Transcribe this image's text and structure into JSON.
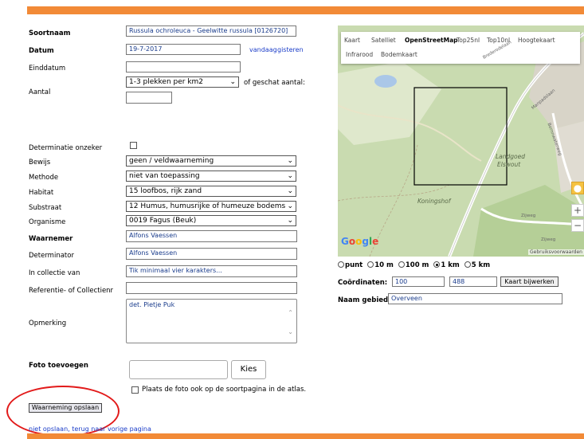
{
  "form": {
    "soortnaam_label": "Soortnaam",
    "soortnaam_value": "Russula ochroleuca - Geelwitte russula [0126720]",
    "datum_label": "Datum",
    "datum_value": "19-7-2017",
    "vandaag": "vandaag",
    "gisteren": "gisteren",
    "einddatum_label": "Einddatum",
    "einddatum_value": "",
    "aantal_label": "Aantal",
    "aantal_select": "1-3 plekken per km2",
    "geschat_label": "of geschat aantal:",
    "geschat_value": "",
    "determinatie_label": "Determinatie onzeker",
    "bewijs_label": "Bewijs",
    "bewijs_value": "geen / veldwaarneming",
    "methode_label": "Methode",
    "methode_value": "niet van toepassing",
    "habitat_label": "Habitat",
    "habitat_value": "15 loofbos, rijk zand",
    "substraat_label": "Substraat",
    "substraat_value": "12 Humus, humusrijke of humeuze bodems",
    "organisme_label": "Organisme",
    "organisme_value": "0019 Fagus (Beuk)",
    "waarnemer_label": "Waarnemer",
    "waarnemer_value": "Alfons Vaessen",
    "determinator_label": "Determinator",
    "determinator_value": "Alfons Vaessen",
    "collectie_label": "In collectie van",
    "collectie_placeholder": "Tik minimaal vier karakters...",
    "referentie_label": "Referentie- of Collectienr",
    "referentie_value": "",
    "opmerking_label": "Opmerking",
    "opmerking_value": "det. Pietje Puk",
    "foto_label": "Foto toevoegen",
    "kies_label": "Kies",
    "plaats_foto_label": "Plaats de foto ook op de soortpagina in de atlas.",
    "save_label": "Waarneming opslaan",
    "back_link": "niet opslaan, terug naar vorige pagina"
  },
  "map": {
    "types_row1": [
      "Kaart",
      "Satelliet",
      "OpenStreetMap",
      "Top25nl",
      "Top10nl",
      "Hoogtekaart"
    ],
    "types_row2": [
      "Infrarood",
      "Bodemkaart"
    ],
    "active_type": "OpenStreetMap",
    "place_labels": [
      "Landgoed",
      "Elswout",
      "Koningshof"
    ],
    "road_labels": [
      "Brederodelaan",
      "Zijweg",
      "Zijweg",
      "Bornnwaterweg",
      "Manpadslaan"
    ],
    "google": "Google",
    "attribution": "Gebruiksvoorwaarden",
    "zoom_in": "+",
    "zoom_out": "−"
  },
  "precision": {
    "options": [
      "punt",
      "10 m",
      "100 m",
      "1 km",
      "5 km"
    ],
    "selected": "1 km",
    "coord_label": "Coördinaten:",
    "coord_x": "100",
    "coord_y": "488",
    "update_button": "Kaart bijwerken",
    "gebied_label": "Naam gebied:",
    "gebied_value": "Overveen"
  },
  "colors": {
    "accent_orange": "#f28a37",
    "annotation_red": "#e21a1a",
    "link_blue": "#1a3cc8"
  }
}
